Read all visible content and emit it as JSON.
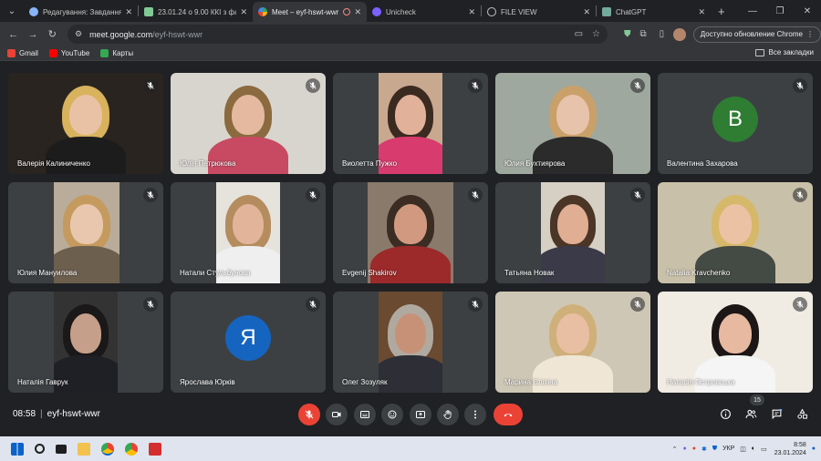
{
  "browser": {
    "tabs": [
      {
        "label": "Редагування: Завдання",
        "favicon_color": "#8ab4f8",
        "active": false
      },
      {
        "label": "23.01.24 о 9.00 ККІ з фахо",
        "favicon_color": "#81c995",
        "active": false
      },
      {
        "label": "Meet – eyf-hswt-wwr",
        "favicon_color": "#fbbc04",
        "active": true,
        "recording": true
      },
      {
        "label": "Unicheck",
        "favicon_color": "#7b61ff",
        "active": false
      },
      {
        "label": "FILE VIEW",
        "favicon_color": "#8ab4f8",
        "active": false
      },
      {
        "label": "ChatGPT",
        "favicon_color": "#74aa9c",
        "active": false
      }
    ],
    "address": {
      "domain": "meet.google.com",
      "path": "/eyf-hswt-wwr"
    },
    "update_button": "Доступно обновление Chrome",
    "bookmarks": [
      {
        "label": "Gmail",
        "color": "#ea4335"
      },
      {
        "label": "YouTube",
        "color": "#ff0000"
      },
      {
        "label": "Карты",
        "color": "#34a853"
      }
    ],
    "all_bookmarks": "Все закладки"
  },
  "meeting": {
    "time": "08:58",
    "code": "eyf-hswt-wwr",
    "participants_count": "15",
    "participants": [
      {
        "name": "Валерія Калиниченко",
        "type": "video"
      },
      {
        "name": "Юлія Петрюкова",
        "type": "video"
      },
      {
        "name": "Виолетта Пужко",
        "type": "video"
      },
      {
        "name": "Юлия Бухтиярова",
        "type": "video"
      },
      {
        "name": "Валентина Захарова",
        "type": "avatar",
        "letter": "В",
        "color": "#2e7d32"
      },
      {
        "name": "Юлия Мануилова",
        "type": "video"
      },
      {
        "name": "Натали Стульбунова",
        "type": "video"
      },
      {
        "name": "Evgenij Shakirov",
        "type": "video"
      },
      {
        "name": "Татьяна Новак",
        "type": "video"
      },
      {
        "name": "Natalia Kravchenko",
        "type": "video"
      },
      {
        "name": "Наталія Гаврук",
        "type": "video"
      },
      {
        "name": "Ярослава Юрків",
        "type": "avatar",
        "letter": "Я",
        "color": "#1565c0"
      },
      {
        "name": "Олег Зозуляк",
        "type": "video"
      },
      {
        "name": "Марина Єліхіна",
        "type": "video"
      },
      {
        "name": "Наталія Островська",
        "type": "video"
      }
    ]
  },
  "taskbar": {
    "language": "УКР",
    "clock_time": "8:58",
    "clock_date": "23.01.2024"
  },
  "colors": {
    "background": "#202124",
    "tile": "#3c4043",
    "end_call": "#ea4335"
  }
}
